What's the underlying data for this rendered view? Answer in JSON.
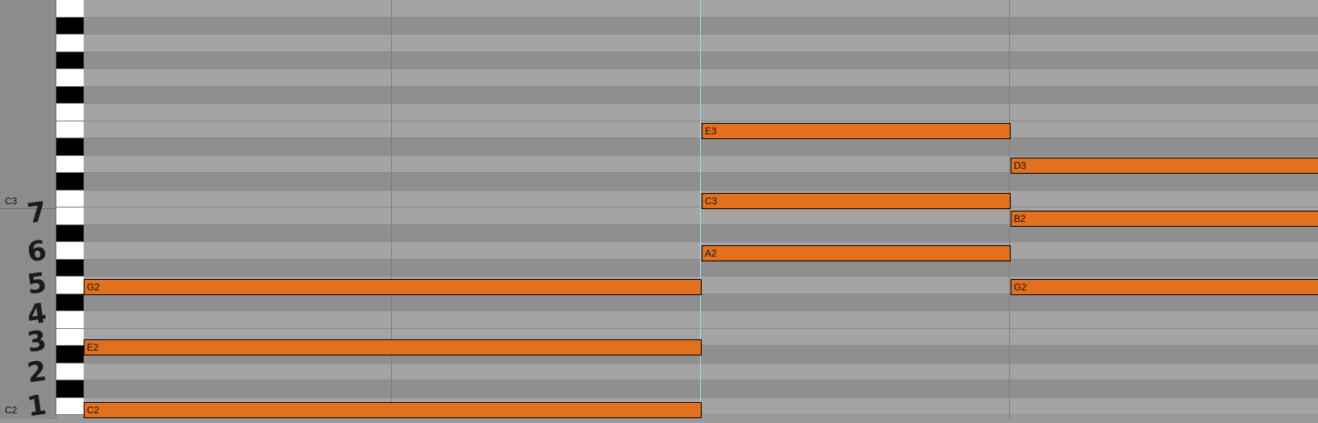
{
  "octave_labels": {
    "upper": "C3",
    "lower": "C2"
  },
  "scale_degrees": [
    "7",
    "6",
    "5",
    "4",
    "3",
    "2",
    "1"
  ],
  "piano_keys": [
    "white",
    "black",
    "white",
    "black",
    "white",
    "black",
    "white",
    "white",
    "black",
    "white",
    "black",
    "white",
    "white",
    "black",
    "white",
    "black",
    "white",
    "black",
    "white",
    "white",
    "black",
    "white",
    "black",
    "white"
  ],
  "notes": [
    {
      "label": "G2"
    },
    {
      "label": "E2"
    },
    {
      "label": "C2"
    },
    {
      "label": "E3"
    },
    {
      "label": "C3"
    },
    {
      "label": "A2"
    },
    {
      "label": "D3"
    },
    {
      "label": "B2"
    },
    {
      "label": "G2"
    }
  ],
  "colors": {
    "note": "#e2701c",
    "playhead": "#8fe6f0",
    "white_key": "#ffffff",
    "black_key": "#000000"
  }
}
